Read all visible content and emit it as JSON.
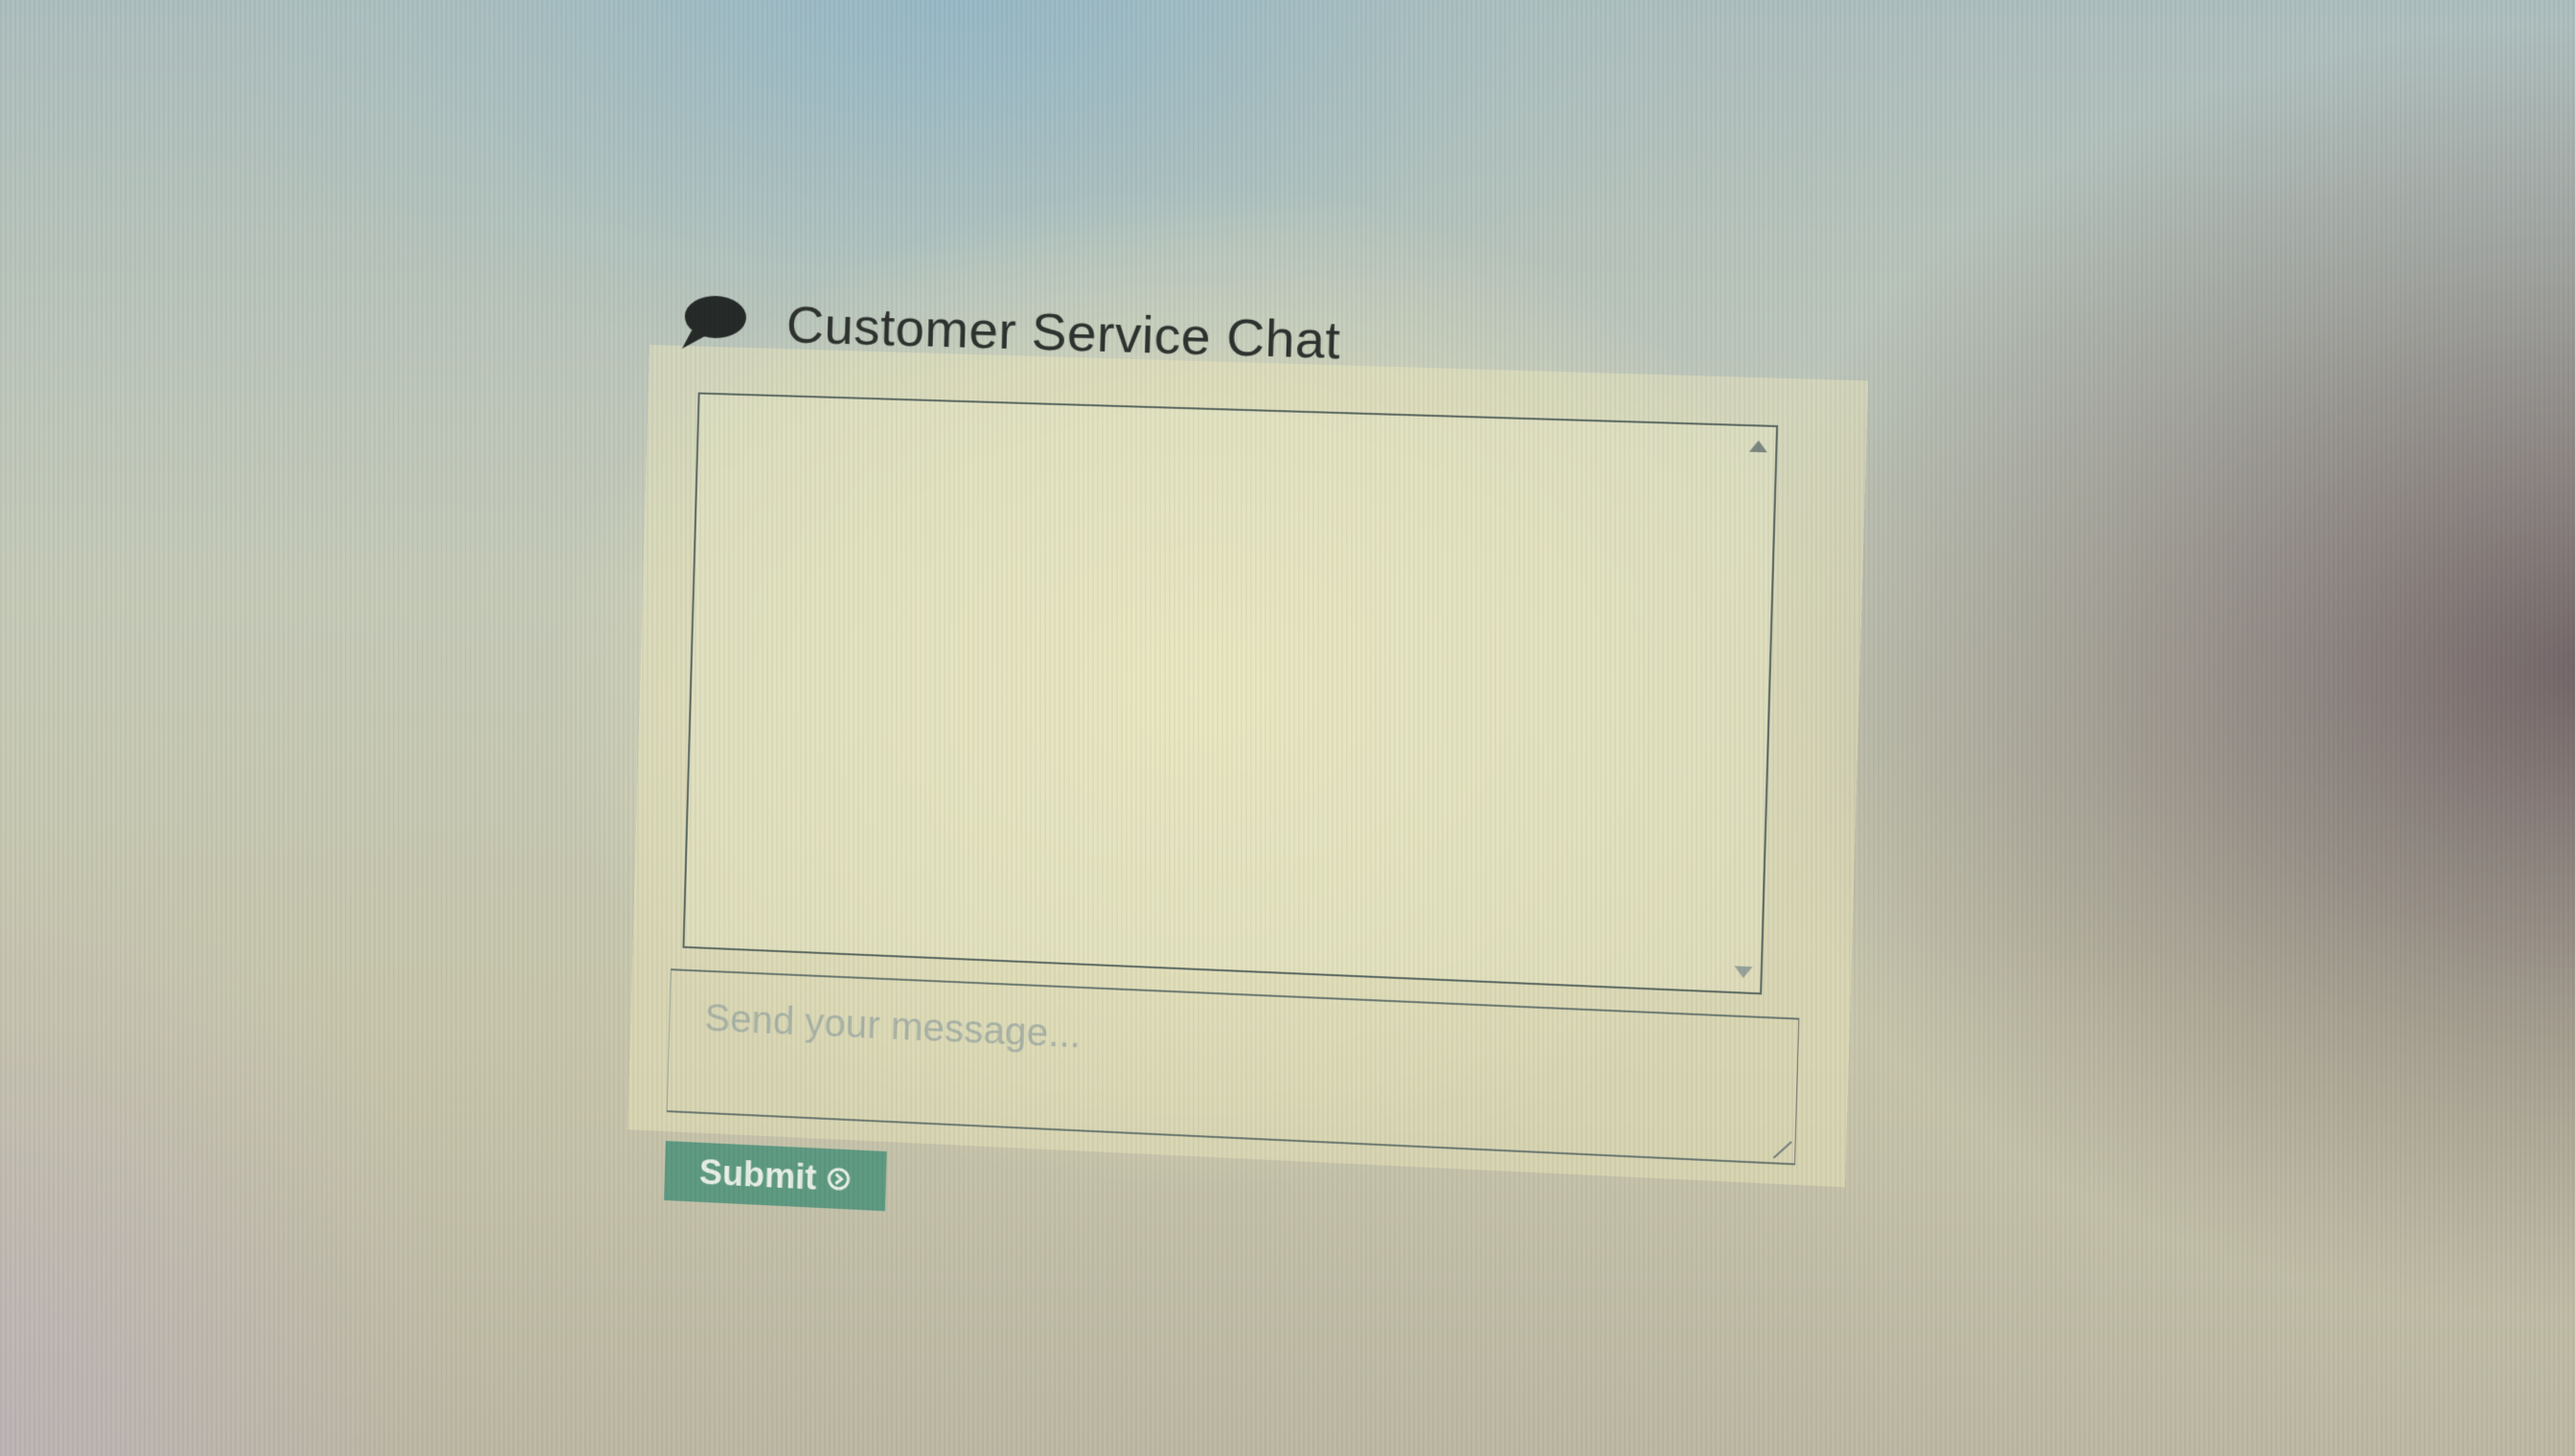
{
  "chat": {
    "title": "Customer Service Chat",
    "icon": "speech-bubble-icon",
    "message_placeholder": "Send your message...",
    "submit_label": "Submit",
    "submit_icon": "arrow-circle-icon"
  },
  "colors": {
    "title_text": "#2e3330",
    "submit_background": "#5f9a82",
    "submit_text": "#e8f0e6"
  }
}
